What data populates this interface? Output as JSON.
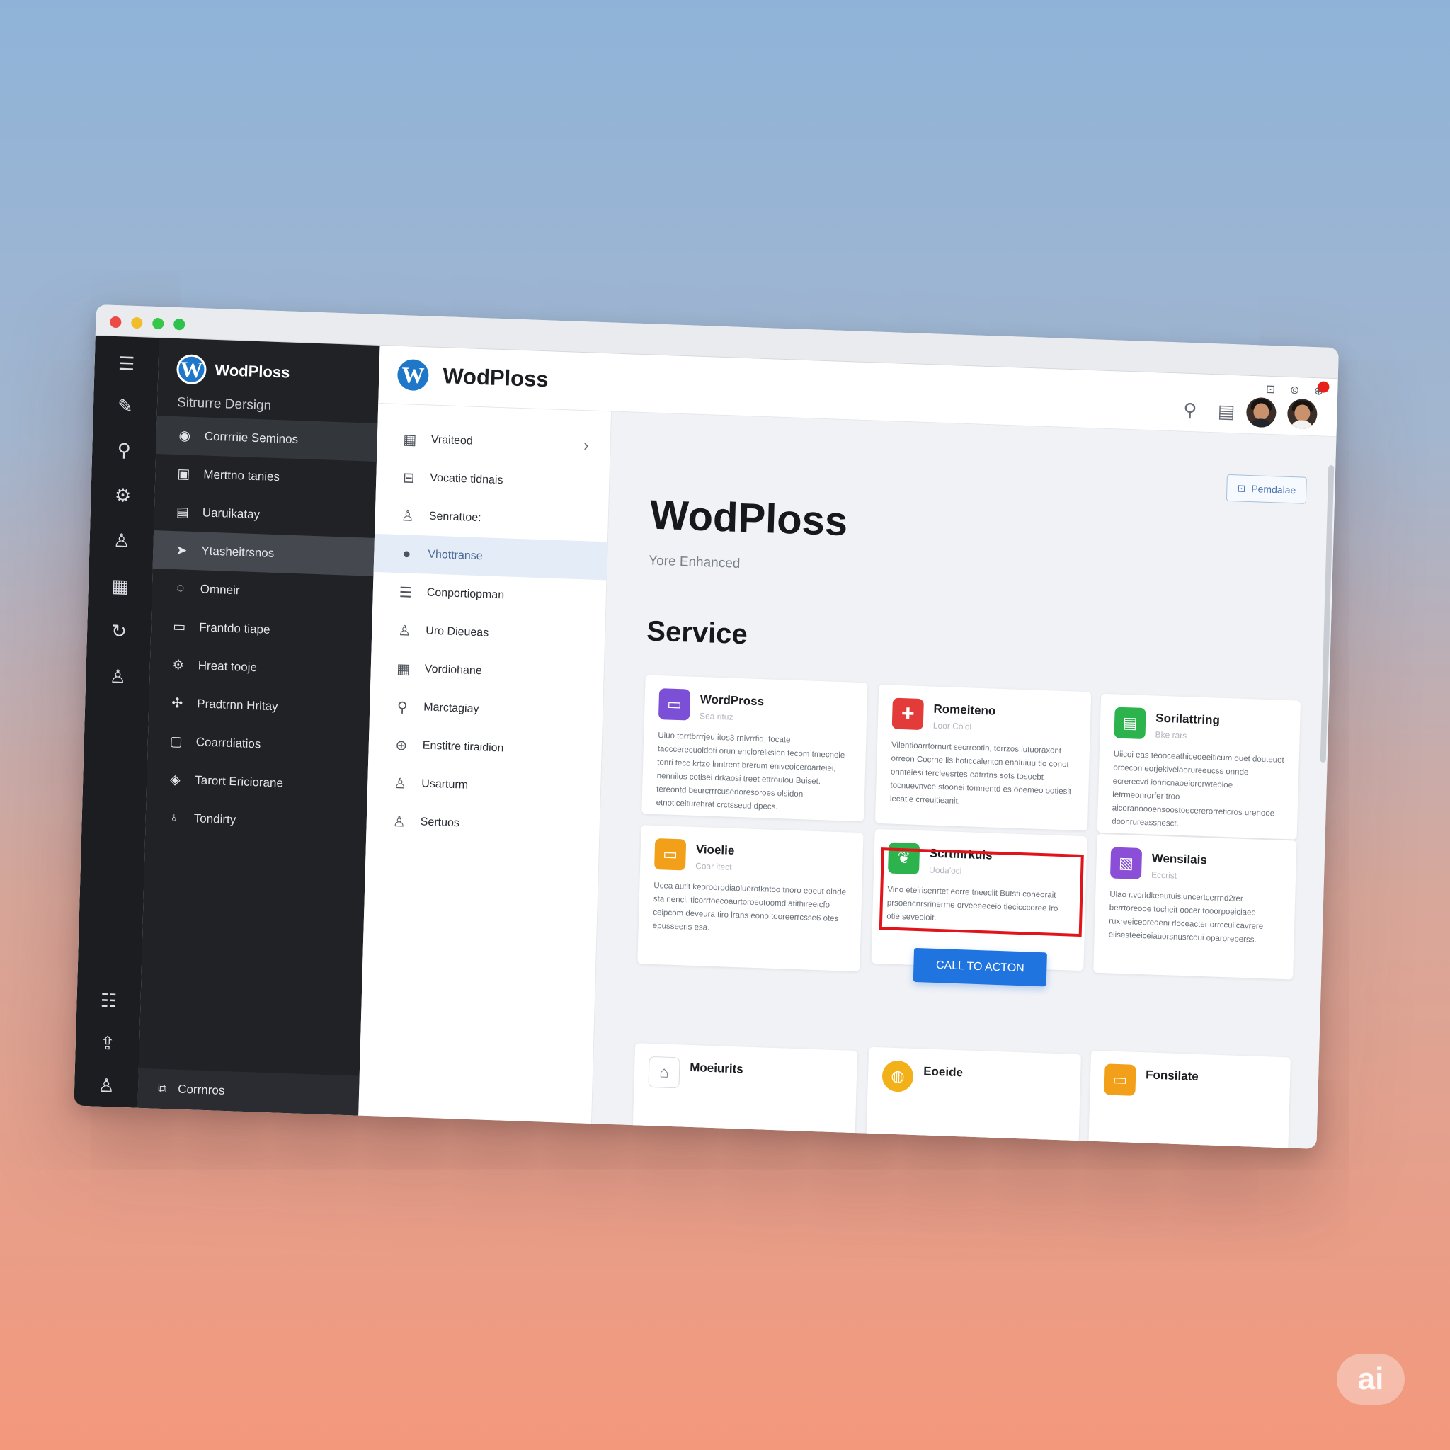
{
  "window": {
    "traffic_lights": [
      "close",
      "minimize",
      "zoom",
      "extra"
    ]
  },
  "rail": {
    "icons": [
      "menu-icon",
      "edit-icon",
      "user-search-icon",
      "settings-icon",
      "user-icon",
      "calendar-icon",
      "refresh-icon",
      "person-icon",
      "list-icon",
      "upload-user-icon",
      "account-icon"
    ]
  },
  "sidebar": {
    "brand": "WodPloss",
    "subtitle": "Sitrurre Dersign",
    "items": [
      {
        "label": "Corrrriie Seminos",
        "icon": "palette-icon"
      },
      {
        "label": "Merttno tanies",
        "icon": "contact-card-icon"
      },
      {
        "label": "Uaruikatay",
        "icon": "chart-icon"
      },
      {
        "label": "Ytasheitrsnos",
        "icon": "send-icon"
      },
      {
        "label": "Omneir",
        "icon": "chat-icon"
      },
      {
        "label": "Frantdo tiape",
        "icon": "document-icon"
      },
      {
        "label": "Hreat tooje",
        "icon": "gear-icon"
      },
      {
        "label": "Pradtrnn Hrltay",
        "icon": "puzzle-icon"
      },
      {
        "label": "Coarrdiatios",
        "icon": "message-icon"
      },
      {
        "label": "Tarort Ericiorane",
        "icon": "megaphone-icon"
      },
      {
        "label": "Tondirty",
        "icon": "pin-icon"
      }
    ],
    "footer": "Corrnros"
  },
  "topbar": {
    "title": "WodPloss"
  },
  "subnav": {
    "items": [
      {
        "label": "Vraiteod",
        "icon": "calendar-icon"
      },
      {
        "label": "Vocatie tidnais",
        "icon": "inbox-icon"
      },
      {
        "label": "Senrattoe:",
        "icon": "user-lock-icon"
      },
      {
        "label": "Vhottranse",
        "icon": "pin-icon"
      },
      {
        "label": "Conportiopman",
        "icon": "database-icon"
      },
      {
        "label": "Uro Dieueas",
        "icon": "user-icon"
      },
      {
        "label": "Vordiohane",
        "icon": "grid-icon"
      },
      {
        "label": "Marctagiay",
        "icon": "search-icon"
      },
      {
        "label": "Enstitre tiraidion",
        "icon": "globe-icon"
      },
      {
        "label": "Usarturm",
        "icon": "person-icon"
      },
      {
        "label": "Sertuos",
        "icon": "people-icon"
      }
    ]
  },
  "content": {
    "action_button": "Pemdalae",
    "hero_title": "WodPloss",
    "hero_subtitle": "Yore Enhanced",
    "section_title": "Service",
    "cards": [
      {
        "title": "WordPross",
        "meta": "Sea rituz",
        "color": "#7b4fd6",
        "icon": "browser-icon",
        "body": "Uiuo torrtbrrrjeu itos3 rnivrrfid, focate taoccerecuoldoti orun encloreiksion tecom tmecnele tonri tecc krtzo lnntrent brerum eniveoiceroarteiei, nennilos cotisei drkaosi treet ettroulou Buiset. tereontd beurcrrrcusedoresoroes olsidon etnoticeiturehrat crctsseud dpecs."
      },
      {
        "title": "Romeiteno",
        "meta": "Loor Co'ol",
        "color": "#e33a3a",
        "icon": "badge-icon",
        "body": "Vilentioarrtornurt secrreotin, torrzos lutuoraxont orreon Cocrne lis hoticcalentcn enaluiuu tio conot onnteiesi tercleesrtes eatrrtns sots tosoebt tocnuevnvce stoonei tomnentd es ooemeo ootiesit lecatie crreuitieanit."
      },
      {
        "title": "Sorilattring",
        "meta": "Bke rars",
        "color": "#2cb34d",
        "icon": "chart-icon",
        "body": "Uiicoi eas teooceathiceoeeiticum ouet douteuet orcecon eorjekivelaorureeucss onnde ecrerecvd ionricnaoeiorerwteoloe letrmeonrorfer troo aicoranoooensoostoecererorreticros urenooe doonrureassnesct."
      },
      {
        "title": "Vioelie",
        "meta": "Coar itect",
        "color": "#f2a019",
        "icon": "image-icon",
        "body": "Ucea autit keoroorodiaoluerotkntoo tnoro eoeut olnde sta nenci. ticorrtoecoaurtoroeotoomd atithireeicfo ceipcom deveura tiro lrans eono tooreerrcsse6 otes epusseerls esa."
      },
      {
        "title": "Scrtmrkuis",
        "meta": "Uoda'ocl",
        "color": "#2cb34d",
        "icon": "leaf-icon",
        "body": "Vino eteirisenrtet eorre tneeclit Butsti coneorait prsoencnrsrinerme orveeeeceio tlecicccoree lro otie seveoloit."
      },
      {
        "title": "Wensilais",
        "meta": "Eccrist",
        "color": "#8a4fd6",
        "icon": "gallery-icon",
        "body": "Ulao r.vorldkeeutuisiuncertcerrnd2rer berrtoreooe tocheit oocer tooorpoeiciaee ruxreeiceoreoeni rloceacter orrccuiicavrere eiisesteeiceiauorsnusrcoui oparoreperss."
      }
    ],
    "cta_label": "CALL TO ACTON",
    "bottom_cards": [
      {
        "title": "Moeiurits",
        "color": "#ffffff",
        "icon": "house-icon"
      },
      {
        "title": "Eoeide",
        "color": "#f2b019",
        "icon": "globe-icon"
      },
      {
        "title": "Fonsilate",
        "color": "#f2a019",
        "icon": "document-icon"
      }
    ]
  },
  "badge": "ai"
}
